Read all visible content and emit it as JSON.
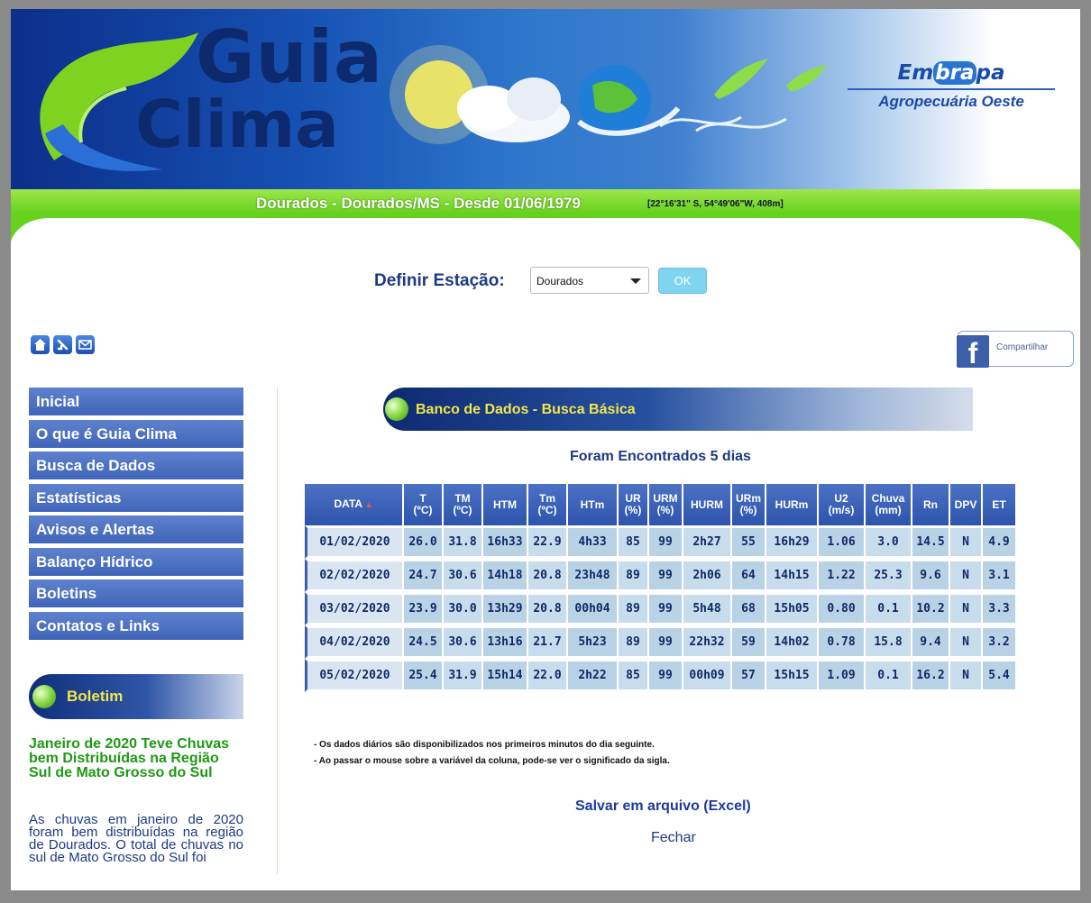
{
  "header": {
    "logo_line1": "Guia",
    "logo_line2": "Clima",
    "partner_name_left": "Em",
    "partner_name_mid": "bra",
    "partner_name_right": "pa",
    "partner_sub": "Agropecuária Oeste"
  },
  "station_bar": {
    "title": "Dourados - Dourados/MS - Desde 01/06/1979",
    "coords": "[22°16'31\" S, 54°49'06\"W, 408m]"
  },
  "station_selector": {
    "label": "Definir Estação:",
    "value": "Dourados",
    "ok_label": "OK"
  },
  "share": {
    "label": "Compartilhar",
    "fb_glyph": "f"
  },
  "menu": {
    "items": [
      {
        "label": "Inicial"
      },
      {
        "label": "O que é Guia Clima"
      },
      {
        "label": "Busca de Dados"
      },
      {
        "label": "Estatísticas"
      },
      {
        "label": "Avisos e Alertas"
      },
      {
        "label": "Balanço Hídrico"
      },
      {
        "label": "Boletins"
      },
      {
        "label": "Contatos e Links"
      }
    ]
  },
  "boletim": {
    "title": "Boletim",
    "headline": "Janeiro de 2020 Teve Chuvas bem Distribuídas na Região Sul de Mato Grosso do Sul",
    "text": "As chuvas em janeiro de 2020 foram bem distribuídas na região de Dourados. O total de chuvas no sul de Mato Grosso do Sul foi"
  },
  "main": {
    "section_title": "Banco de Dados - Busca Básica",
    "result_count": "Foram Encontrados 5 dias",
    "table": {
      "headers": [
        [
          "DATA",
          ""
        ],
        [
          "T",
          "(ºC)"
        ],
        [
          "TM",
          "(ºC)"
        ],
        [
          "HTM",
          ""
        ],
        [
          "Tm",
          "(ºC)"
        ],
        [
          "HTm",
          ""
        ],
        [
          "UR",
          "(%)"
        ],
        [
          "URM",
          "(%)"
        ],
        [
          "HURM",
          ""
        ],
        [
          "URm",
          "(%)"
        ],
        [
          "HURm",
          ""
        ],
        [
          "U2",
          "(m/s)"
        ],
        [
          "Chuva",
          "(mm)"
        ],
        [
          "Rn",
          ""
        ],
        [
          "DPV",
          ""
        ],
        [
          "ET",
          ""
        ]
      ],
      "rows": [
        [
          "01/02/2020",
          "26.0",
          "31.8",
          "16h33",
          "22.9",
          "4h33",
          "85",
          "99",
          "2h27",
          "55",
          "16h29",
          "1.06",
          "3.0",
          "14.5",
          "N",
          "4.9"
        ],
        [
          "02/02/2020",
          "24.7",
          "30.6",
          "14h18",
          "20.8",
          "23h48",
          "89",
          "99",
          "2h06",
          "64",
          "14h15",
          "1.22",
          "25.3",
          "9.6",
          "N",
          "3.1"
        ],
        [
          "03/02/2020",
          "23.9",
          "30.0",
          "13h29",
          "20.8",
          "00h04",
          "89",
          "99",
          "5h48",
          "68",
          "15h05",
          "0.80",
          "0.1",
          "10.2",
          "N",
          "3.3"
        ],
        [
          "04/02/2020",
          "24.5",
          "30.6",
          "13h16",
          "21.7",
          "5h23",
          "89",
          "99",
          "22h32",
          "59",
          "14h02",
          "0.78",
          "15.8",
          "9.4",
          "N",
          "3.2"
        ],
        [
          "05/02/2020",
          "25.4",
          "31.9",
          "15h14",
          "22.0",
          "2h22",
          "85",
          "99",
          "00h09",
          "57",
          "15h15",
          "1.09",
          "0.1",
          "16.2",
          "N",
          "5.4"
        ]
      ]
    },
    "notes": [
      "- Os dados diários são disponibilizados nos primeiros minutos do dia seguinte.",
      "- Ao passar o mouse sobre a variável da coluna, pode-se ver o significado da sigla."
    ],
    "save_link": "Salvar em arquivo (Excel)",
    "close_link": "Fechar"
  }
}
